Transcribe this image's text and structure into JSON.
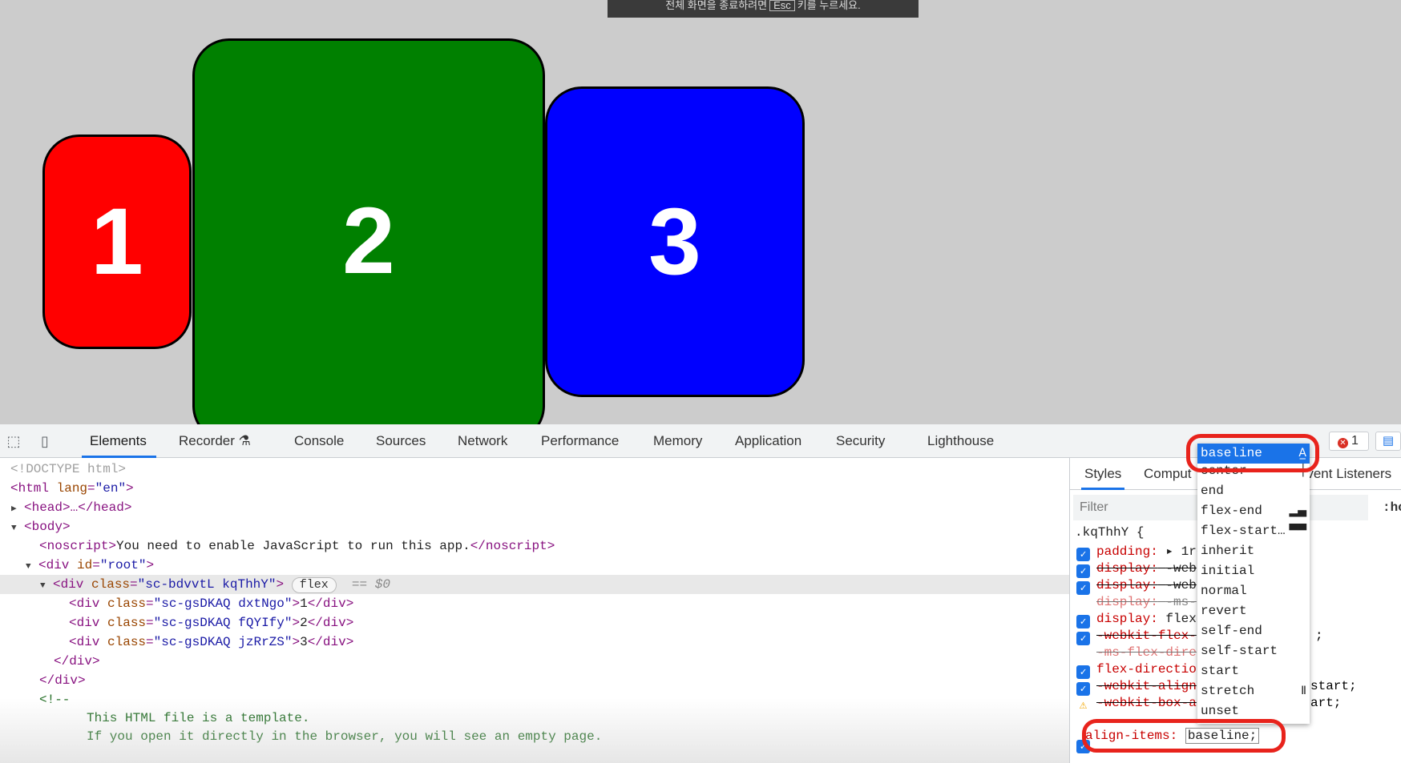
{
  "toast": {
    "text_before": "전체 화면을 종료하려면",
    "key": "Esc",
    "text_after": "키를 누르세요."
  },
  "boxes": [
    {
      "label": "1",
      "color": "#ff0000"
    },
    {
      "label": "2",
      "color": "#008000"
    },
    {
      "label": "3",
      "color": "#0000ff"
    }
  ],
  "devtools": {
    "tabs": [
      "Elements",
      "Recorder",
      "Console",
      "Sources",
      "Network",
      "Performance",
      "Memory",
      "Application",
      "Security",
      "Lighthouse"
    ],
    "active_tab": "Elements",
    "error_count": "1",
    "dom": {
      "doctype": "<!DOCTYPE html>",
      "html_open": "<html",
      "lang_attr": "lang",
      "lang_val": "\"en\"",
      "head": "<head>…</head>",
      "body_open": "<body>",
      "noscript_open": "<noscript>",
      "noscript_text": "You need to enable JavaScript to run this app.",
      "noscript_close": "</noscript>",
      "root_open": "<div",
      "root_attr": "id",
      "root_val": "\"root\"",
      "flex_div_open": "<div",
      "flex_div_attr": "class",
      "flex_div_val": "\"sc-bdvvtL kqThhY\"",
      "flex_badge": "flex",
      "dollar": "== $0",
      "children": [
        {
          "cls": "\"sc-gsDKAQ dxtNgo\"",
          "text": "1"
        },
        {
          "cls": "\"sc-gsDKAQ fQYIfy\"",
          "text": "2"
        },
        {
          "cls": "\"sc-gsDKAQ jzRrZS\"",
          "text": "3"
        }
      ],
      "div_close": "</div>",
      "comment_open": "<!--",
      "comment_line1": "This HTML file is a template.",
      "comment_line2": "If you open it directly in the browser, you will see an empty page."
    },
    "styles": {
      "tabs": [
        "Styles",
        "Comput",
        "Event Listeners"
      ],
      "filter_placeholder": "Filter",
      "hov": ":ho",
      "selector": ".kqThhY {",
      "props": [
        {
          "name": "padding:",
          "value": "▸ 1re",
          "state": "on"
        },
        {
          "name": "display:",
          "value": "-web",
          "state": "strike"
        },
        {
          "name": "display:",
          "value": "-web",
          "state": "strike"
        },
        {
          "name": "display:",
          "value": "-ms-",
          "state": "dimstrike"
        },
        {
          "name": "display:",
          "value": "flex",
          "state": "on"
        },
        {
          "name": "-webkit-flex-",
          "value": "",
          "state": "strike"
        },
        {
          "name": "-ms-flex-dire",
          "value": "",
          "state": "dimstrike"
        },
        {
          "name": "flex-directio",
          "value": "",
          "state": "on"
        },
        {
          "name": "-webkit-align",
          "value": "",
          "state": "strike"
        },
        {
          "name": "-webkit-box-a",
          "value": "",
          "state": "warn"
        }
      ],
      "right_fragments": [
        ";",
        "start;",
        "art;"
      ],
      "edit_prop": "align-items:",
      "edit_value": "baseline;"
    },
    "autocomplete": {
      "options": [
        "baseline",
        "center",
        "end",
        "flex-end",
        "flex-start…",
        "inherit",
        "initial",
        "normal",
        "revert",
        "self-end",
        "self-start",
        "start",
        "stretch",
        "unset"
      ],
      "selected": "baseline",
      "icon_colors": {
        "highlight": "#e8231c",
        "accent": "#1a73e8"
      }
    }
  }
}
